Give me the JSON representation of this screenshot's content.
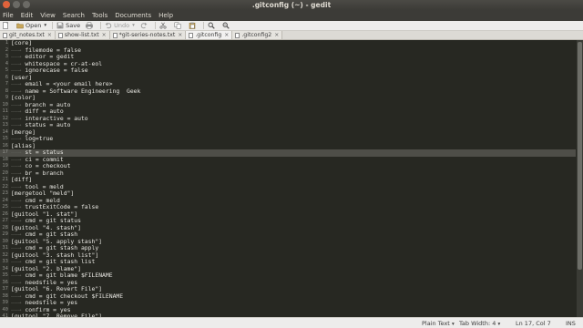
{
  "window": {
    "title": ".gitconfig (~) - gedit"
  },
  "menu": [
    "File",
    "Edit",
    "View",
    "Search",
    "Tools",
    "Documents",
    "Help"
  ],
  "toolbar": {
    "open_label": "Open",
    "open_arrow": "▾",
    "save_label": "Save",
    "undo_label": "Undo",
    "undo_arrow": "▾"
  },
  "tabs": [
    {
      "label": "git_notes.txt",
      "active": false
    },
    {
      "label": "show-list.txt",
      "active": false
    },
    {
      "label": "*git-series-notes.txt",
      "active": false
    },
    {
      "label": ".gitconfig",
      "active": true
    },
    {
      "label": ".gitconfig2",
      "active": false
    }
  ],
  "editor": {
    "current_line": 17,
    "lines": [
      {
        "n": "1",
        "t": "[core]"
      },
      {
        "n": "2",
        "t": "\t filemode = false"
      },
      {
        "n": "3",
        "t": "\t editor = gedit"
      },
      {
        "n": "4",
        "t": "\t whitespace = cr-at-eol"
      },
      {
        "n": "5",
        "t": "\t ignorecase = false"
      },
      {
        "n": "6",
        "t": "[user]"
      },
      {
        "n": "7",
        "t": "\t email = <your email here>"
      },
      {
        "n": "8",
        "t": "\t name = Software Engineering  Geek"
      },
      {
        "n": "9",
        "t": "[color]"
      },
      {
        "n": "10",
        "t": "\t branch = auto"
      },
      {
        "n": "11",
        "t": "\t diff = auto"
      },
      {
        "n": "12",
        "t": "\t interactive = auto"
      },
      {
        "n": "13",
        "t": "\t status = auto"
      },
      {
        "n": "14",
        "t": "[merge]"
      },
      {
        "n": "15",
        "t": "\t log=true"
      },
      {
        "n": "16",
        "t": "[alias]"
      },
      {
        "n": "17",
        "t": "\t st = status"
      },
      {
        "n": "18",
        "t": "\t ci = commit"
      },
      {
        "n": "19",
        "t": "\t co = checkout"
      },
      {
        "n": "20",
        "t": "\t br = branch"
      },
      {
        "n": "21",
        "t": "[diff]"
      },
      {
        "n": "22",
        "t": "\t tool = meld"
      },
      {
        "n": "23",
        "t": "[mergetool \"meld\"]"
      },
      {
        "n": "24",
        "t": "\t cmd = meld"
      },
      {
        "n": "25",
        "t": "\t trustExitCode = false"
      },
      {
        "n": "26",
        "t": "[guitool \"1. stat\"]"
      },
      {
        "n": "27",
        "t": "\t cmd = git status"
      },
      {
        "n": "28",
        "t": "[guitool \"4. stash\"]"
      },
      {
        "n": "29",
        "t": "\t cmd = git stash"
      },
      {
        "n": "30",
        "t": "[guitool \"5. apply stash\"]"
      },
      {
        "n": "31",
        "t": "\t cmd = git stash apply"
      },
      {
        "n": "32",
        "t": "[guitool \"3. stash list\"]"
      },
      {
        "n": "33",
        "t": "\t cmd = git stash list"
      },
      {
        "n": "34",
        "t": "[guitool \"2. blame\"]"
      },
      {
        "n": "35",
        "t": "\t cmd = git blame $FILENAME"
      },
      {
        "n": "36",
        "t": "\t needsfile = yes"
      },
      {
        "n": "37",
        "t": "[guitool \"6. Revert File\"]"
      },
      {
        "n": "38",
        "t": "\t cmd = git checkout $FILENAME"
      },
      {
        "n": "39",
        "t": "\t needsfile = yes"
      },
      {
        "n": "40",
        "t": "\t confirm = yes"
      },
      {
        "n": "41",
        "t": "[guitool \"7. Remove File\"]"
      },
      {
        "n": "42",
        "t": "\t cmd = rm $FILENAME"
      }
    ]
  },
  "statusbar": {
    "language": "Plain Text",
    "tab_width": "Tab Width: 4",
    "position": "Ln 17, Col 7",
    "mode": "INS",
    "dropdown_arrow": "▾"
  },
  "colors": {
    "editor_bg": "#272822",
    "current_line_bg": "#4e4e48",
    "close_button": "#e0633b"
  }
}
